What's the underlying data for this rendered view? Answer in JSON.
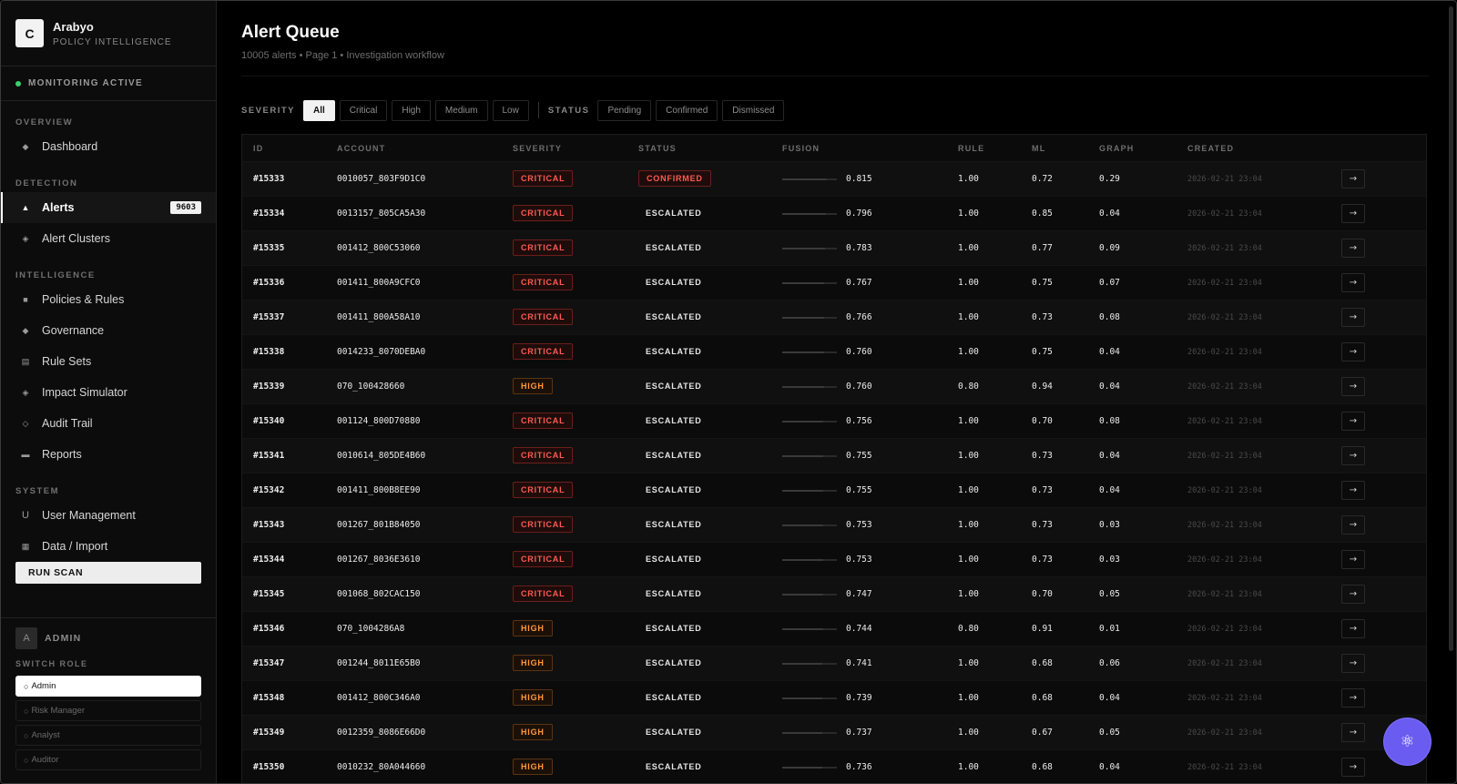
{
  "app": {
    "logo_letter": "C",
    "name": "Arabyo",
    "subtitle": "POLICY INTELLIGENCE",
    "monitoring": "MONITORING ACTIVE"
  },
  "sidebar": {
    "sections": {
      "overview": "OVERVIEW",
      "detection": "DETECTION",
      "intelligence": "INTELLIGENCE",
      "system": "SYSTEM"
    },
    "items": {
      "dashboard": "Dashboard",
      "alerts": "Alerts",
      "alerts_badge": "9603",
      "alert_clusters": "Alert Clusters",
      "policies": "Policies & Rules",
      "governance": "Governance",
      "rule_sets": "Rule Sets",
      "impact_simulator": "Impact Simulator",
      "audit_trail": "Audit Trail",
      "reports": "Reports",
      "user_management": "User Management",
      "data_import": "Data / Import"
    },
    "icons": {
      "dashboard": "◆",
      "alerts": "▲",
      "alert_clusters": "◈",
      "policies": "■",
      "governance": "◆",
      "rule_sets": "▤",
      "impact_simulator": "◈",
      "audit_trail": "◇",
      "reports": "▬",
      "user_management": "U",
      "data_import": "▦"
    },
    "run_scan": "RUN SCAN",
    "user": {
      "avatar": "A",
      "role_label": "ADMIN",
      "switch_role": "SWITCH ROLE",
      "roles": [
        "Admin",
        "Risk Manager",
        "Analyst",
        "Auditor"
      ],
      "active_role": "Admin"
    }
  },
  "page": {
    "title": "Alert Queue",
    "subtitle": "10005 alerts • Page 1 • Investigation workflow"
  },
  "filters": {
    "severity_label": "SEVERITY",
    "severity": [
      "All",
      "Critical",
      "High",
      "Medium",
      "Low"
    ],
    "severity_active": "All",
    "status_label": "STATUS",
    "status": [
      "Pending",
      "Confirmed",
      "Dismissed"
    ]
  },
  "table": {
    "headers": {
      "id": "ID",
      "account": "ACCOUNT",
      "severity": "SEVERITY",
      "status": "STATUS",
      "fusion": "FUSION",
      "rule": "RULE",
      "ml": "ML",
      "graph": "GRAPH",
      "created": "CREATED"
    },
    "action_icon": "→",
    "rows": [
      {
        "id": "#15333",
        "account": "0010057_803F9D1C0",
        "severity": "CRITICAL",
        "status": "CONFIRMED",
        "fusion": "0.815",
        "rule": "1.00",
        "ml": "0.72",
        "graph": "0.29",
        "created": "2026-02-21 23:04"
      },
      {
        "id": "#15334",
        "account": "0013157_805CA5A30",
        "severity": "CRITICAL",
        "status": "ESCALATED",
        "fusion": "0.796",
        "rule": "1.00",
        "ml": "0.85",
        "graph": "0.04",
        "created": "2026-02-21 23:04"
      },
      {
        "id": "#15335",
        "account": "001412_800C53060",
        "severity": "CRITICAL",
        "status": "ESCALATED",
        "fusion": "0.783",
        "rule": "1.00",
        "ml": "0.77",
        "graph": "0.09",
        "created": "2026-02-21 23:04"
      },
      {
        "id": "#15336",
        "account": "001411_800A9CFC0",
        "severity": "CRITICAL",
        "status": "ESCALATED",
        "fusion": "0.767",
        "rule": "1.00",
        "ml": "0.75",
        "graph": "0.07",
        "created": "2026-02-21 23:04"
      },
      {
        "id": "#15337",
        "account": "001411_800A58A10",
        "severity": "CRITICAL",
        "status": "ESCALATED",
        "fusion": "0.766",
        "rule": "1.00",
        "ml": "0.73",
        "graph": "0.08",
        "created": "2026-02-21 23:04"
      },
      {
        "id": "#15338",
        "account": "0014233_8070DEBA0",
        "severity": "CRITICAL",
        "status": "ESCALATED",
        "fusion": "0.760",
        "rule": "1.00",
        "ml": "0.75",
        "graph": "0.04",
        "created": "2026-02-21 23:04"
      },
      {
        "id": "#15339",
        "account": "070_100428660",
        "severity": "HIGH",
        "status": "ESCALATED",
        "fusion": "0.760",
        "rule": "0.80",
        "ml": "0.94",
        "graph": "0.04",
        "created": "2026-02-21 23:04"
      },
      {
        "id": "#15340",
        "account": "001124_800D70880",
        "severity": "CRITICAL",
        "status": "ESCALATED",
        "fusion": "0.756",
        "rule": "1.00",
        "ml": "0.70",
        "graph": "0.08",
        "created": "2026-02-21 23:04"
      },
      {
        "id": "#15341",
        "account": "0010614_805DE4B60",
        "severity": "CRITICAL",
        "status": "ESCALATED",
        "fusion": "0.755",
        "rule": "1.00",
        "ml": "0.73",
        "graph": "0.04",
        "created": "2026-02-21 23:04"
      },
      {
        "id": "#15342",
        "account": "001411_800B8EE90",
        "severity": "CRITICAL",
        "status": "ESCALATED",
        "fusion": "0.755",
        "rule": "1.00",
        "ml": "0.73",
        "graph": "0.04",
        "created": "2026-02-21 23:04"
      },
      {
        "id": "#15343",
        "account": "001267_801B84050",
        "severity": "CRITICAL",
        "status": "ESCALATED",
        "fusion": "0.753",
        "rule": "1.00",
        "ml": "0.73",
        "graph": "0.03",
        "created": "2026-02-21 23:04"
      },
      {
        "id": "#15344",
        "account": "001267_8036E3610",
        "severity": "CRITICAL",
        "status": "ESCALATED",
        "fusion": "0.753",
        "rule": "1.00",
        "ml": "0.73",
        "graph": "0.03",
        "created": "2026-02-21 23:04"
      },
      {
        "id": "#15345",
        "account": "001068_802CAC150",
        "severity": "CRITICAL",
        "status": "ESCALATED",
        "fusion": "0.747",
        "rule": "1.00",
        "ml": "0.70",
        "graph": "0.05",
        "created": "2026-02-21 23:04"
      },
      {
        "id": "#15346",
        "account": "070_1004286A8",
        "severity": "HIGH",
        "status": "ESCALATED",
        "fusion": "0.744",
        "rule": "0.80",
        "ml": "0.91",
        "graph": "0.01",
        "created": "2026-02-21 23:04"
      },
      {
        "id": "#15347",
        "account": "001244_8011E65B0",
        "severity": "HIGH",
        "status": "ESCALATED",
        "fusion": "0.741",
        "rule": "1.00",
        "ml": "0.68",
        "graph": "0.06",
        "created": "2026-02-21 23:04"
      },
      {
        "id": "#15348",
        "account": "001412_800C346A0",
        "severity": "HIGH",
        "status": "ESCALATED",
        "fusion": "0.739",
        "rule": "1.00",
        "ml": "0.68",
        "graph": "0.04",
        "created": "2026-02-21 23:04"
      },
      {
        "id": "#15349",
        "account": "0012359_8086E66D0",
        "severity": "HIGH",
        "status": "ESCALATED",
        "fusion": "0.737",
        "rule": "1.00",
        "ml": "0.67",
        "graph": "0.05",
        "created": "2026-02-21 23:04"
      },
      {
        "id": "#15350",
        "account": "0010232_80A044660",
        "severity": "HIGH",
        "status": "ESCALATED",
        "fusion": "0.736",
        "rule": "1.00",
        "ml": "0.68",
        "graph": "0.04",
        "created": "2026-02-21 23:04"
      }
    ]
  },
  "fab_icon": "⚛",
  "colors": {
    "critical": "#ff5a52",
    "high": "#ff9a3c",
    "monitor_dot": "#3ecf6e",
    "fab": "#6a5cf0"
  }
}
